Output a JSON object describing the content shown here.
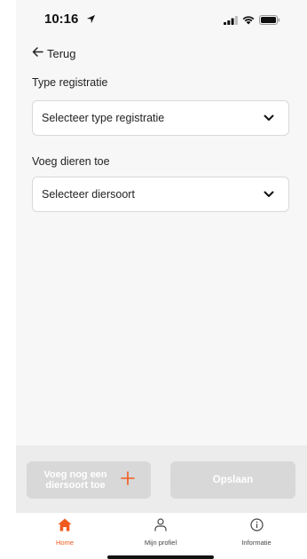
{
  "status_bar": {
    "time": "10:16"
  },
  "navigation": {
    "back_label": "Terug"
  },
  "form": {
    "type_label": "Type registratie",
    "type_placeholder": "Selecteer type registratie",
    "animals_label": "Voeg dieren toe",
    "animals_placeholder": "Selecteer diersoort"
  },
  "actions": {
    "add_species_label": "Voeg nog een diersoort toe",
    "save_label": "Opslaan"
  },
  "tab_bar": {
    "tabs": [
      {
        "label": "Home",
        "icon": "home-icon",
        "active": true
      },
      {
        "label": "Mijn profiel",
        "icon": "user-icon",
        "active": false
      },
      {
        "label": "Informatie",
        "icon": "info-icon",
        "active": false
      }
    ]
  },
  "colors": {
    "accent": "#f05a1e",
    "disabled_button": "#d8d8d8",
    "background": "#f7f7f7"
  }
}
